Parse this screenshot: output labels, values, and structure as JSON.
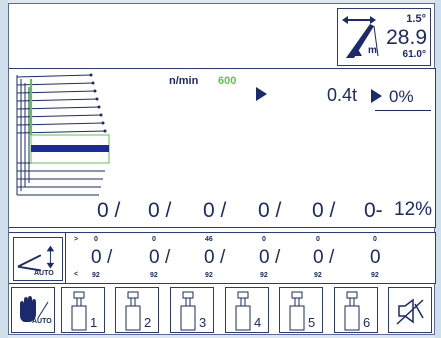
{
  "angle_display": {
    "top": "1.5°",
    "main": "28.9",
    "bottom": "61.0°",
    "unit_label": "m"
  },
  "load": {
    "speed_label": "n/min",
    "speed_value": "600",
    "load_value": "0.4t",
    "percent": "0%"
  },
  "sections": {
    "values": [
      "0 /",
      "0 /",
      "0 /",
      "0 /",
      "0 /",
      "0-"
    ],
    "percent": "12%"
  },
  "boom": {
    "auto_label": "AUTO",
    "top_marker": ">",
    "bottom_marker": "<",
    "columns": [
      {
        "top": "0",
        "main": "0",
        "bottom": "92"
      },
      {
        "top": "0",
        "main": "0",
        "bottom": "92"
      },
      {
        "top": "46",
        "main": "0",
        "bottom": "92"
      },
      {
        "top": "0",
        "main": "0",
        "bottom": "92"
      },
      {
        "top": "0",
        "main": "0",
        "bottom": "92"
      },
      {
        "top": "0",
        "main": "0",
        "bottom": "92"
      }
    ]
  },
  "buttons": {
    "manual_auto_label": "AUTO",
    "cylinders": [
      "1",
      "2",
      "3",
      "4",
      "5",
      "6"
    ]
  },
  "colors": {
    "primary": "#1a2a6c",
    "accent_green": "#5fc54a",
    "bar_blue": "#1a2a9c"
  }
}
